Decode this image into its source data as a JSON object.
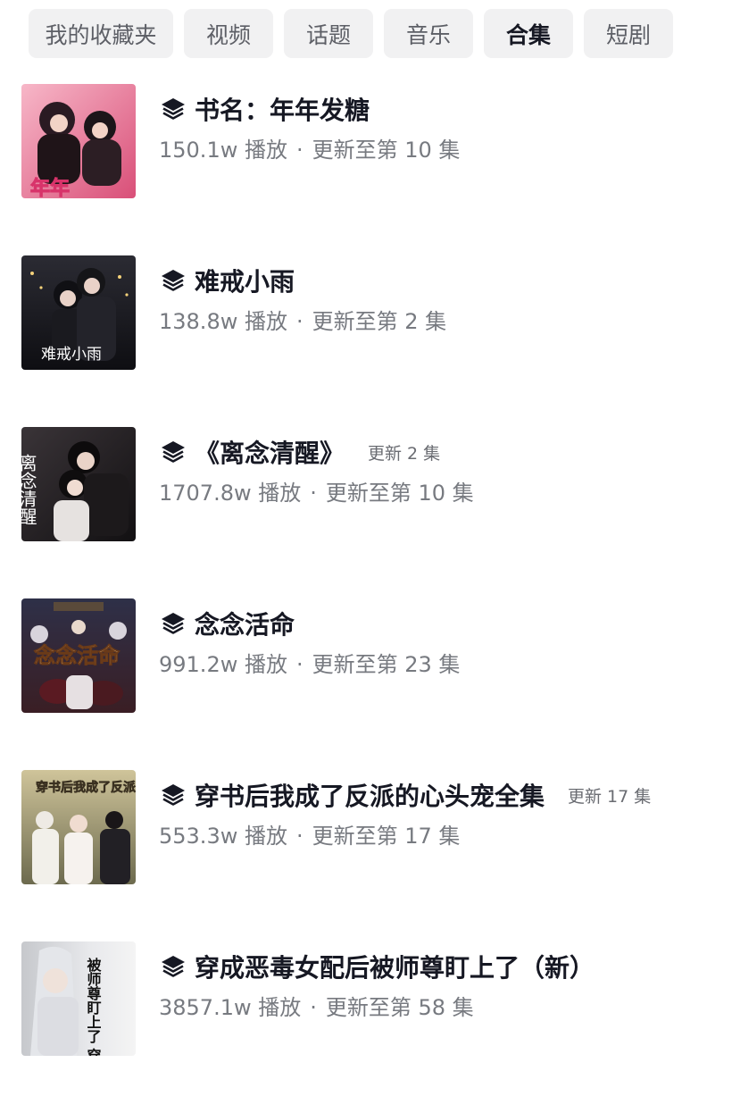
{
  "tabs": [
    {
      "label": "我的收藏夹",
      "active": false
    },
    {
      "label": "视频",
      "active": false
    },
    {
      "label": "话题",
      "active": false
    },
    {
      "label": "音乐",
      "active": false
    },
    {
      "label": "合集",
      "active": true
    },
    {
      "label": "短剧",
      "active": false
    }
  ],
  "icons": {
    "collection": "stack-layers-icon"
  },
  "items": [
    {
      "title": "书名：年年发糖",
      "plays": "150.1w 播放",
      "progress": "更新至第 10 集",
      "badge": "",
      "cover_text": "年年"
    },
    {
      "title": "难戒小雨",
      "plays": "138.8w 播放",
      "progress": "更新至第 2 集",
      "badge": "",
      "cover_text": "难戒小雨"
    },
    {
      "title": "《离念清醒》",
      "plays": "1707.8w 播放",
      "progress": "更新至第 10 集",
      "badge": "更新 2 集",
      "cover_text": "离念清醒"
    },
    {
      "title": "念念活命",
      "plays": "991.2w 播放",
      "progress": "更新至第 23 集",
      "badge": "",
      "cover_text": "念念活命"
    },
    {
      "title": "穿书后我成了反派的心头宠全集",
      "plays": "553.3w 播放",
      "progress": "更新至第 17 集",
      "badge": "更新 17 集",
      "cover_text": "穿书后我成了反派的心头宠"
    },
    {
      "title": "穿成恶毒女配后被师尊盯上了（新）",
      "plays": "3857.1w 播放",
      "progress": "更新至第 58 集",
      "badge": "",
      "cover_text": "被师尊盯上了 穿成恶毒女配"
    }
  ],
  "meta_separator": "·",
  "colors": {
    "tab_bg": "#f1f1f2",
    "title": "#161823",
    "meta": "#777a80"
  }
}
